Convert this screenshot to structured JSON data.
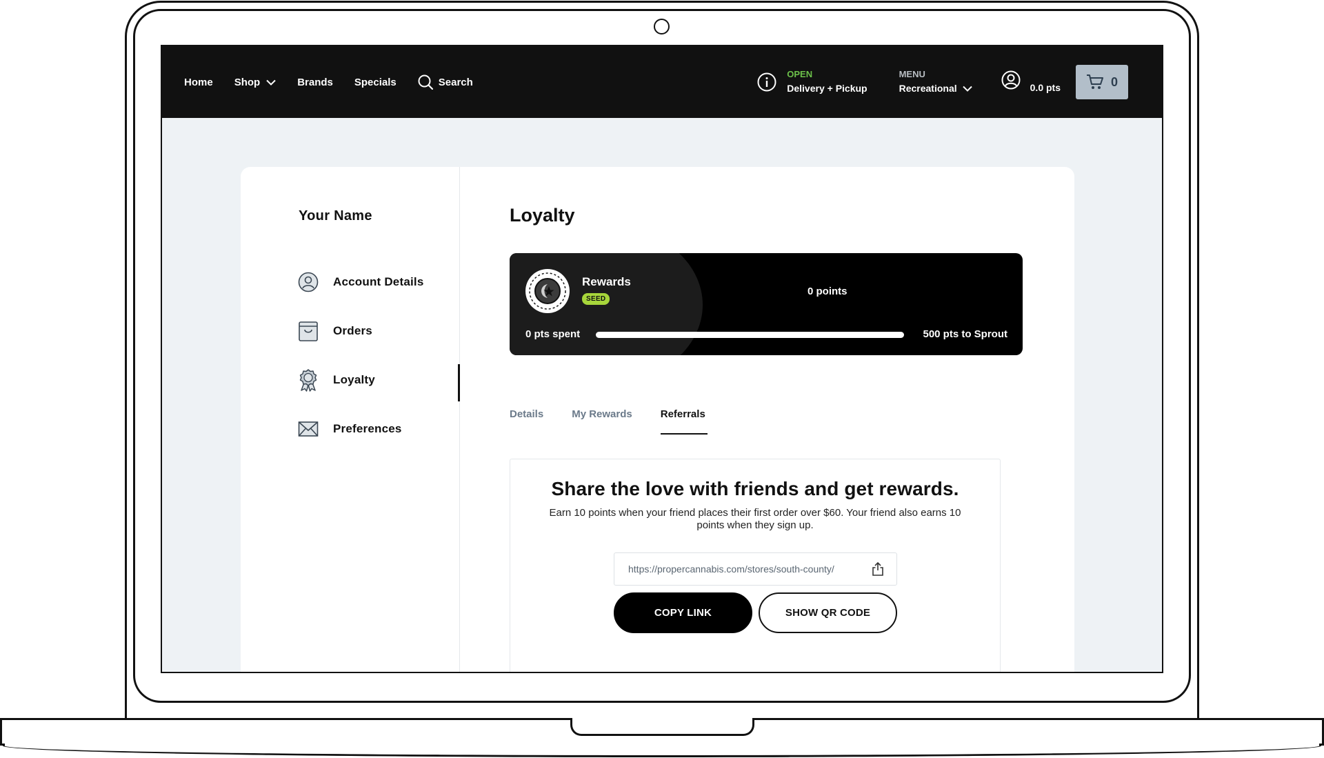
{
  "nav": {
    "home": "Home",
    "shop": "Shop",
    "brands": "Brands",
    "specials": "Specials",
    "search": "Search"
  },
  "status": {
    "state": "OPEN",
    "mode": "Delivery + Pickup"
  },
  "menu": {
    "label": "MENU",
    "value": "Recreational"
  },
  "account": {
    "points": "0.0 pts"
  },
  "cart": {
    "count": "0"
  },
  "sidebar": {
    "user_name": "Your Name",
    "items": [
      {
        "label": "Account Details",
        "icon": "user-icon"
      },
      {
        "label": "Orders",
        "icon": "bag-icon"
      },
      {
        "label": "Loyalty",
        "icon": "award-icon"
      },
      {
        "label": "Preferences",
        "icon": "mail-icon"
      }
    ],
    "active": "Loyalty"
  },
  "main": {
    "title": "Loyalty",
    "rewards": {
      "label": "Rewards",
      "tier": "SEED",
      "points": "0 points",
      "spent": "0 pts spent",
      "next": "500 pts to Sprout",
      "progress": 0
    },
    "tabs": [
      {
        "label": "Details",
        "active": false
      },
      {
        "label": "My Rewards",
        "active": false
      },
      {
        "label": "Referrals",
        "active": true
      }
    ],
    "referral": {
      "title": "Share the love with friends and get rewards.",
      "description": "Earn 10 points when your friend places their first order over $60. Your friend also earns 10 points when they sign up.",
      "link": "https://propercannabis.com/stores/south-county/",
      "copy_label": "COPY LINK",
      "qr_label": "SHOW QR CODE"
    }
  },
  "colors": {
    "topbar": "#111111",
    "open": "#6cc04a",
    "accent_pill": "#a7d63b",
    "cart": "#b2bec9",
    "page_bg": "#eef2f5"
  }
}
